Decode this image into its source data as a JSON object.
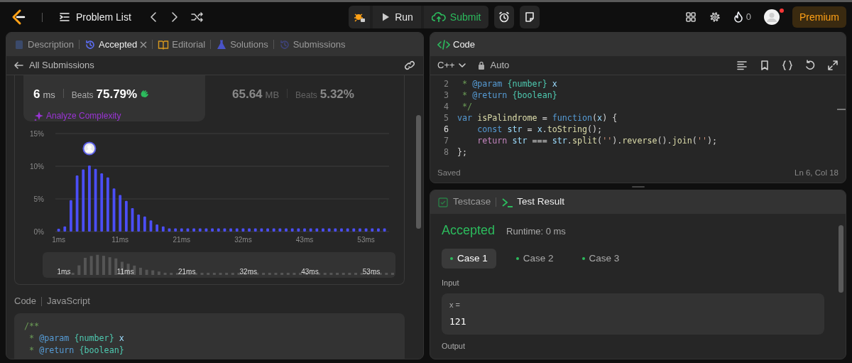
{
  "top_bar": {
    "title": "Problem List",
    "run": "Run",
    "submit": "Submit",
    "streak": "0",
    "notification": true,
    "premium": "Premium"
  },
  "left_panel": {
    "tabs": [
      {
        "label": "Description",
        "selected": false,
        "closable": false
      },
      {
        "label": "Accepted",
        "selected": true,
        "closable": true
      },
      {
        "label": "Editorial",
        "selected": false,
        "closable": false
      },
      {
        "label": "Solutions",
        "selected": false,
        "closable": false
      },
      {
        "label": "Submissions",
        "selected": false,
        "closable": false
      }
    ],
    "back_label": "All Submissions",
    "stats": [
      {
        "value": "6",
        "unit": "ms",
        "beats_label": "Beats",
        "beats": "75.79%",
        "selected": true
      },
      {
        "value": "65.64",
        "unit": "MB",
        "beats_label": "Beats",
        "beats": "5.32%",
        "selected": false
      }
    ],
    "analyze": "Analyze Complexity",
    "chart_data": {
      "type": "bar",
      "ylim": [
        0,
        15
      ],
      "yticks": [
        {
          "value": 0,
          "label": "0%"
        },
        {
          "value": 5,
          "label": "5%"
        },
        {
          "value": 10,
          "label": "10%"
        },
        {
          "value": 15,
          "label": "15%"
        }
      ],
      "categories": [
        "1ms",
        null,
        null,
        null,
        null,
        null,
        null,
        null,
        null,
        null,
        "11ms",
        null,
        null,
        null,
        null,
        null,
        null,
        null,
        null,
        null,
        "21ms",
        null,
        null,
        null,
        null,
        null,
        null,
        null,
        null,
        null,
        "32ms",
        null,
        null,
        null,
        null,
        null,
        null,
        null,
        null,
        null,
        "43ms",
        null,
        null,
        null,
        null,
        null,
        null,
        null,
        null,
        null,
        "53ms",
        null,
        null,
        null
      ],
      "series": [
        {
          "color": "#4b4ef7",
          "values": [
            0.4,
            0.8,
            4.8,
            8.6,
            9.5,
            null,
            9.6,
            8.9,
            8.3,
            6.6,
            5.6,
            4.7,
            3.6,
            2.6,
            2.3,
            1.7,
            1.1,
            0.8,
            0.5,
            0.5,
            0.5,
            0.5,
            0.5,
            0.5,
            0.5,
            0.5,
            0.5,
            0.5,
            0.5,
            0.5,
            0.5,
            0.5,
            0.5,
            0.5,
            0.5,
            0.5,
            0.5,
            0.5,
            0.5,
            0.5,
            0.5,
            0.5,
            0.5,
            0.5,
            0.5,
            0.5,
            0.5,
            0.5,
            0.5,
            0.5,
            0.5,
            0.5,
            0.5,
            0.5
          ]
        },
        {
          "color": "#4b4ef7",
          "values": [
            null,
            null,
            null,
            null,
            null,
            10.1,
            null,
            null,
            null,
            null,
            null,
            null,
            null,
            null,
            null,
            null,
            null,
            null,
            null,
            null,
            null,
            null,
            null,
            null,
            null,
            null,
            null,
            null,
            null,
            null,
            null,
            null,
            null,
            null,
            null,
            null,
            null,
            null,
            null,
            null,
            null,
            null,
            null,
            null,
            null,
            null,
            null,
            null,
            null,
            null,
            null,
            null,
            null,
            null
          ]
        }
      ]
    },
    "overview_labels": [
      "1ms",
      "11ms",
      "21ms",
      "32ms",
      "43ms",
      "53ms"
    ],
    "code_label": "Code",
    "code_language": "JavaScript",
    "code_lines": [
      [
        {
          "kind": "comment",
          "text": "/**"
        }
      ],
      [
        {
          "kind": "comment",
          "text": " * "
        },
        {
          "kind": "tag",
          "text": "@param"
        },
        {
          "kind": "type",
          "text": " {number}"
        },
        {
          "kind": "variable",
          "text": " x"
        }
      ],
      [
        {
          "kind": "comment",
          "text": " * "
        },
        {
          "kind": "tag",
          "text": "@return"
        },
        {
          "kind": "type",
          "text": " {boolean}"
        }
      ]
    ]
  },
  "editor": {
    "title": "Code",
    "language": "C++",
    "mode": "Auto",
    "lines": [
      {
        "number": "2",
        "current": false,
        "tokens": [
          {
            "kind": "comment",
            "text": " * "
          },
          {
            "kind": "tag",
            "text": "@param"
          },
          {
            "kind": "type",
            "text": " {number}"
          },
          {
            "kind": "variable",
            "text": " x"
          }
        ]
      },
      {
        "number": "3",
        "current": false,
        "tokens": [
          {
            "kind": "comment",
            "text": " * "
          },
          {
            "kind": "tag",
            "text": "@return"
          },
          {
            "kind": "type",
            "text": " {boolean}"
          }
        ]
      },
      {
        "number": "4",
        "current": false,
        "tokens": [
          {
            "kind": "comment",
            "text": " */"
          }
        ]
      },
      {
        "number": "5",
        "current": false,
        "tokens": [
          {
            "kind": "keyword",
            "text": "var"
          },
          {
            "kind": "function",
            "text": " isPalindrome"
          },
          {
            "kind": "plain",
            "text": " = "
          },
          {
            "kind": "keyword",
            "text": "function"
          },
          {
            "kind": "plain",
            "text": "("
          },
          {
            "kind": "variable",
            "text": "x"
          },
          {
            "kind": "plain",
            "text": ") {"
          }
        ]
      },
      {
        "number": "6",
        "current": true,
        "tokens": [
          {
            "kind": "keyword",
            "text": "    const"
          },
          {
            "kind": "variable",
            "text": " str"
          },
          {
            "kind": "plain",
            "text": " = "
          },
          {
            "kind": "variable",
            "text": "x"
          },
          {
            "kind": "plain",
            "text": "."
          },
          {
            "kind": "function",
            "text": "toString"
          },
          {
            "kind": "plain",
            "text": "();"
          }
        ]
      },
      {
        "number": "7",
        "current": false,
        "tokens": [
          {
            "kind": "control",
            "text": "    return"
          },
          {
            "kind": "variable",
            "text": " str"
          },
          {
            "kind": "plain",
            "text": " === "
          },
          {
            "kind": "variable",
            "text": "str"
          },
          {
            "kind": "plain",
            "text": "."
          },
          {
            "kind": "function",
            "text": "split"
          },
          {
            "kind": "plain",
            "text": "("
          },
          {
            "kind": "string",
            "text": "''"
          },
          {
            "kind": "plain",
            "text": ")."
          },
          {
            "kind": "function",
            "text": "reverse"
          },
          {
            "kind": "plain",
            "text": "()."
          },
          {
            "kind": "function",
            "text": "join"
          },
          {
            "kind": "plain",
            "text": "("
          },
          {
            "kind": "string",
            "text": "''"
          },
          {
            "kind": "plain",
            "text": ");"
          }
        ]
      },
      {
        "number": "8",
        "current": false,
        "tokens": [
          {
            "kind": "plain",
            "text": "};"
          }
        ]
      }
    ],
    "status": "Saved",
    "cursor": "Ln 6, Col 18"
  },
  "result_panel": {
    "tabs": [
      {
        "label": "Testcase",
        "selected": false
      },
      {
        "label": "Test Result",
        "selected": true
      }
    ],
    "verdict": "Accepted",
    "runtime": "Runtime: 0 ms",
    "cases": [
      {
        "label": "Case 1",
        "selected": true,
        "passed": true
      },
      {
        "label": "Case 2",
        "selected": false,
        "passed": true
      },
      {
        "label": "Case 3",
        "selected": false,
        "passed": true
      }
    ],
    "input_label": "Input",
    "input_name": "x =",
    "input_value": "121",
    "output_label": "Output"
  }
}
